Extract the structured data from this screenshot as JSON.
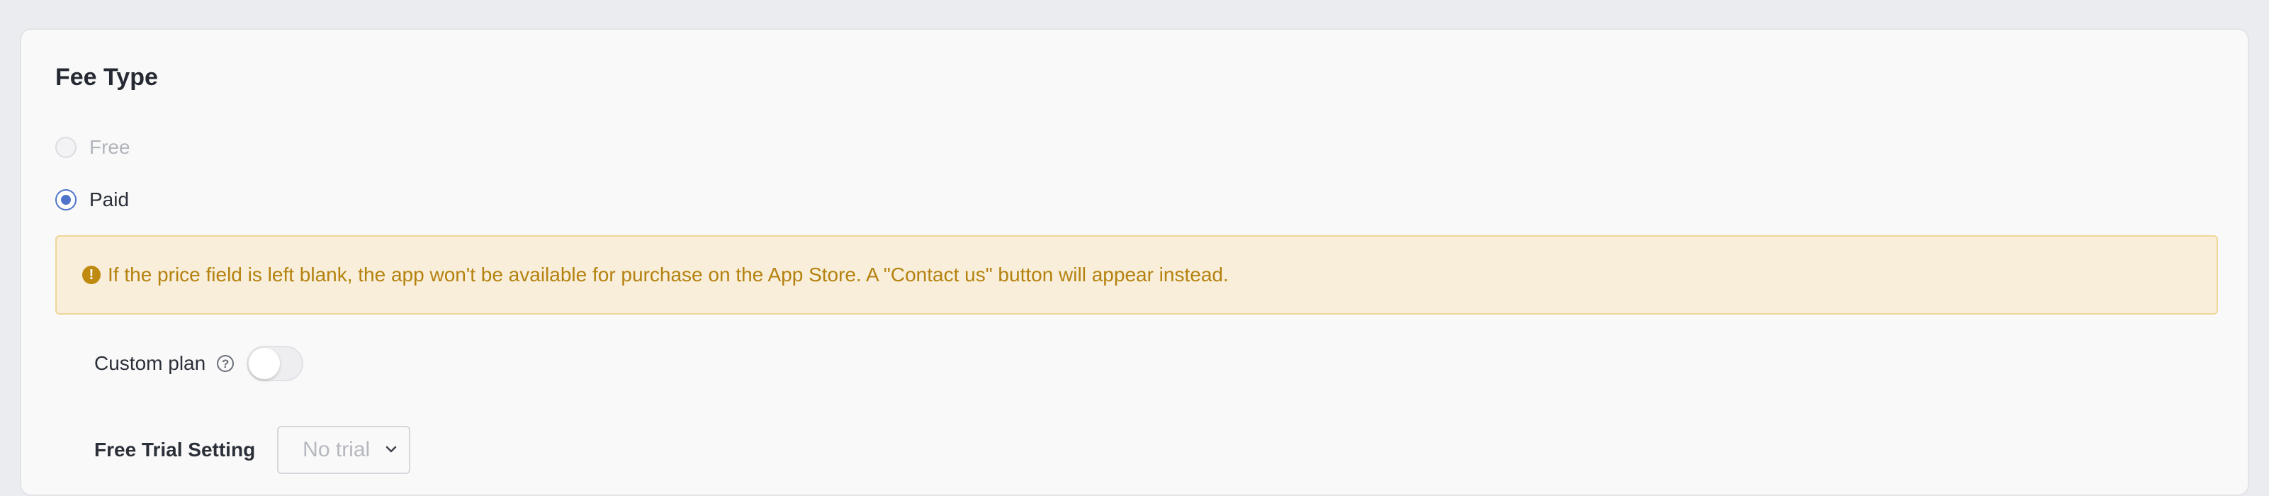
{
  "fee_type": {
    "title": "Fee Type",
    "options": [
      {
        "label": "Free",
        "checked": false,
        "disabled": true
      },
      {
        "label": "Paid",
        "checked": true,
        "disabled": false
      }
    ]
  },
  "notice": {
    "icon": "warning-icon",
    "text": "If the price field is left blank, the app won't be available for purchase on the App Store. A \"Contact us\" button will appear instead.",
    "color": "#b5820f",
    "background": "#f8eed9"
  },
  "custom_plan": {
    "label": "Custom plan",
    "help_icon": "question-circle-icon",
    "enabled": false
  },
  "free_trial": {
    "label": "Free Trial Setting",
    "selected": "No trial"
  },
  "colors": {
    "accent": "#4f74c9"
  }
}
